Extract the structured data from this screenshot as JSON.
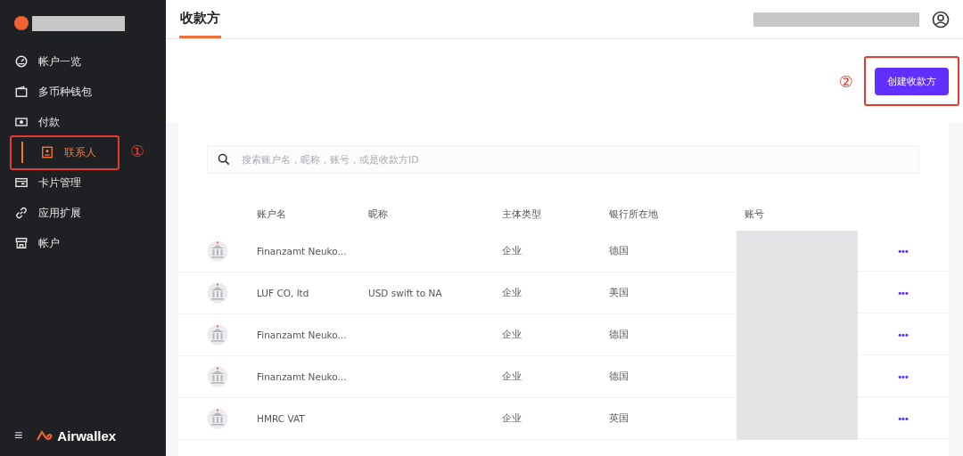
{
  "sidebar": {
    "items": [
      {
        "label": "帐户一览",
        "selected": false
      },
      {
        "label": "多币种钱包",
        "selected": false
      },
      {
        "label": "付款",
        "selected": false
      },
      {
        "label": "联系人",
        "selected": true,
        "annotation": "①"
      },
      {
        "label": "卡片管理",
        "selected": false
      },
      {
        "label": "应用扩展",
        "selected": false
      },
      {
        "label": "帐户",
        "selected": false
      }
    ],
    "menu_icon": "≡",
    "brand": "Airwallex"
  },
  "header": {
    "tabs": [
      {
        "label": "收款方",
        "selected": true
      }
    ]
  },
  "actions": {
    "annotation": "②",
    "create_button": "创建收款方"
  },
  "search": {
    "placeholder": "搜索账户名，昵称，账号，或是收款方ID"
  },
  "table": {
    "columns": [
      "账户名",
      "昵称",
      "主体类型",
      "银行所在地",
      "账号"
    ],
    "rows": [
      {
        "name": "Finanzamt Neuko...",
        "nickname": "",
        "type": "企业",
        "location": "德国",
        "more": "•••"
      },
      {
        "name": "LUF CO, ltd",
        "nickname": "USD swift to NA",
        "type": "企业",
        "location": "美国",
        "more": "•••"
      },
      {
        "name": "Finanzamt Neuko...",
        "nickname": "",
        "type": "企业",
        "location": "德国",
        "more": "•••"
      },
      {
        "name": "Finanzamt Neuko...",
        "nickname": "",
        "type": "企业",
        "location": "德国",
        "more": "•••"
      },
      {
        "name": "HMRC VAT",
        "nickname": "",
        "type": "企业",
        "location": "英国",
        "more": "•••"
      }
    ]
  }
}
